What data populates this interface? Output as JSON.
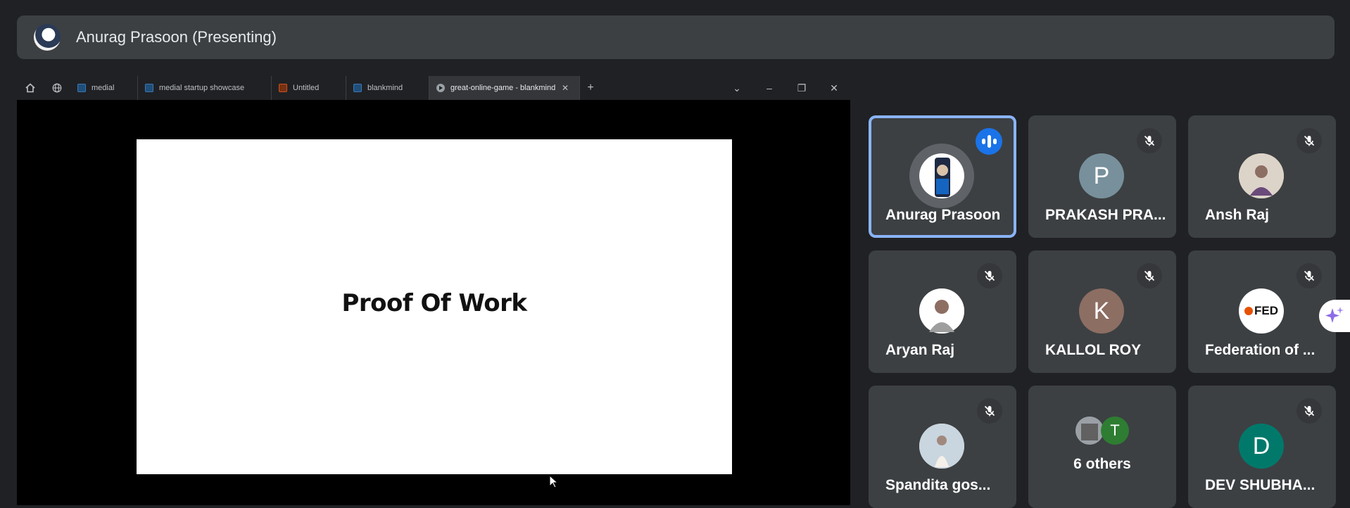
{
  "presenter": {
    "name": "Anurag Prasoon (Presenting)"
  },
  "browser": {
    "tabs": [
      {
        "label": "medial",
        "favicon": "blue"
      },
      {
        "label": "medial startup showcase",
        "favicon": "blue"
      },
      {
        "label": "Untitled",
        "favicon": "orange"
      },
      {
        "label": "blankmind",
        "favicon": "blue"
      },
      {
        "label": "great-online-game - blankmind",
        "favicon": "play",
        "active": true
      }
    ],
    "new_tab": "+",
    "controls": {
      "dropdown": "⌄",
      "minimize": "–",
      "restore": "❐",
      "close": "✕"
    }
  },
  "slide": {
    "title": "Proof Of Work"
  },
  "participants": [
    {
      "name": "Anurag Prasoon",
      "speaking": true,
      "avatar_color": "#1a1a1a"
    },
    {
      "name": "PRAKASH PRA...",
      "initial": "P",
      "avatar_color": "#78909c"
    },
    {
      "name": "Ansh Raj",
      "avatar_color": "#c5b7a8"
    },
    {
      "name": "Aryan Raj",
      "avatar_color": "#d8d2c8"
    },
    {
      "name": "KALLOL ROY",
      "initial": "K",
      "avatar_color": "#8d6e63"
    },
    {
      "name": "Federation of ...",
      "logo_text": "FED",
      "avatar_color": "#ffffff"
    },
    {
      "name": "Spandita gos...",
      "avatar_color": "#d9cfc4"
    },
    {
      "others_label": "6 others",
      "initial": "T",
      "avatar_color": "#2e7d32"
    },
    {
      "name": "DEV SHUBHA...",
      "initial": "D",
      "avatar_color": "#00796b"
    }
  ],
  "colors": {
    "background": "#202124",
    "tile": "#3c4043",
    "speaking": "#8ab4f8",
    "accent": "#1a73e8"
  }
}
